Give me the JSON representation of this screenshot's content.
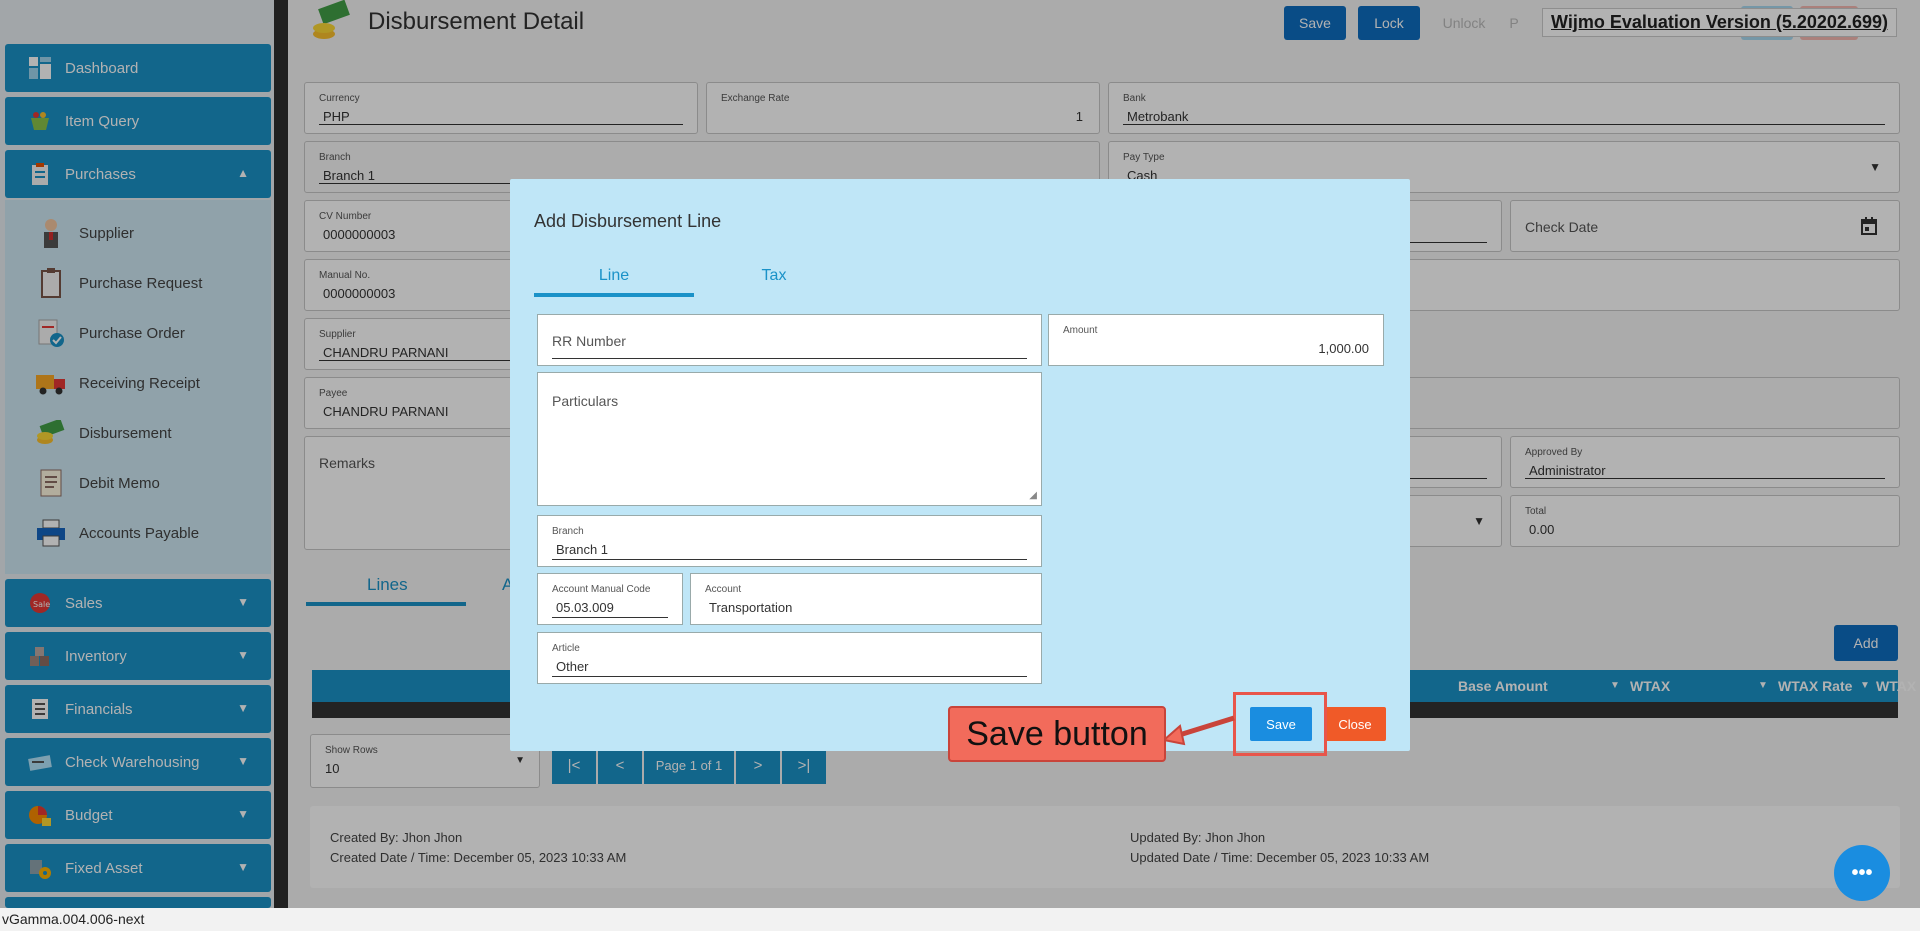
{
  "sidebar": {
    "items": [
      {
        "label": "Dashboard"
      },
      {
        "label": "Item Query"
      },
      {
        "label": "Purchases"
      },
      {
        "label": "Sales"
      },
      {
        "label": "Inventory"
      },
      {
        "label": "Financials"
      },
      {
        "label": "Check Warehousing"
      },
      {
        "label": "Budget"
      },
      {
        "label": "Fixed Asset"
      }
    ],
    "sub_items": [
      {
        "label": "Supplier"
      },
      {
        "label": "Purchase Request"
      },
      {
        "label": "Purchase Order"
      },
      {
        "label": "Receiving Receipt"
      },
      {
        "label": "Disbursement"
      },
      {
        "label": "Debit Memo"
      },
      {
        "label": "Accounts Payable"
      }
    ]
  },
  "header": {
    "title": "Disbursement Detail",
    "save_label": "Save",
    "lock_label": "Lock",
    "unlock_label": "Unlock",
    "extra_label": "P",
    "wijmo_label": "Wijmo Evaluation Version (5.20202.699)"
  },
  "form": {
    "currency": {
      "label": "Currency",
      "value": "PHP"
    },
    "exchange_rate": {
      "label": "Exchange Rate",
      "value": "1"
    },
    "bank": {
      "label": "Bank",
      "value": "Metrobank"
    },
    "branch": {
      "label": "Branch",
      "value": "Branch 1"
    },
    "pay_type": {
      "label": "Pay Type",
      "value": "Cash"
    },
    "cv_number": {
      "label": "CV Number",
      "value": "0000000003"
    },
    "check_date": {
      "placeholder": "Check Date"
    },
    "manual_no": {
      "label": "Manual No.",
      "value": "0000000003"
    },
    "supplier": {
      "label": "Supplier",
      "value": "CHANDRU PARNANI"
    },
    "payee": {
      "label": "Payee",
      "value": "CHANDRU PARNANI"
    },
    "remarks": {
      "placeholder": "Remarks"
    },
    "approved_by": {
      "label": "Approved By",
      "value": "Administrator"
    },
    "total": {
      "label": "Total",
      "value": "0.00"
    }
  },
  "lower_tabs": {
    "lines": "Lines",
    "second": "A"
  },
  "add_label": "Add",
  "grid": {
    "columns": [
      "Base Amount",
      "WTAX",
      "WTAX Rate",
      "WTAX"
    ]
  },
  "pager": {
    "show_rows_label": "Show Rows",
    "show_rows_value": "10",
    "first": "|<",
    "prev": "<",
    "page_text": "Page 1 of 1",
    "next": ">",
    "last": ">|"
  },
  "footer": {
    "created_by": "Created By: Jhon Jhon",
    "created_date": "Created Date / Time: December 05, 2023 10:33 AM",
    "updated_by": "Updated By: Jhon Jhon",
    "updated_date": "Updated Date / Time: December 05, 2023 10:33 AM"
  },
  "modal": {
    "title": "Add Disbursement Line",
    "tabs": [
      "Line",
      "Tax"
    ],
    "rr_number": {
      "placeholder": "RR Number"
    },
    "amount": {
      "label": "Amount",
      "value": "1,000.00"
    },
    "particulars": {
      "placeholder": "Particulars"
    },
    "branch": {
      "label": "Branch",
      "value": "Branch 1"
    },
    "account_manual_code": {
      "label": "Account Manual Code",
      "value": "05.03.009"
    },
    "account": {
      "label": "Account",
      "value": "Transportation"
    },
    "article": {
      "label": "Article",
      "value": "Other"
    },
    "save_label": "Save",
    "close_label": "Close"
  },
  "annotation": {
    "label": "Save button"
  },
  "fab_label": "•••",
  "version": "vGamma.004.006-next",
  "colors": {
    "primary": "#1a92c8",
    "danger": "#f05a28",
    "callout": "#f26b5b"
  }
}
